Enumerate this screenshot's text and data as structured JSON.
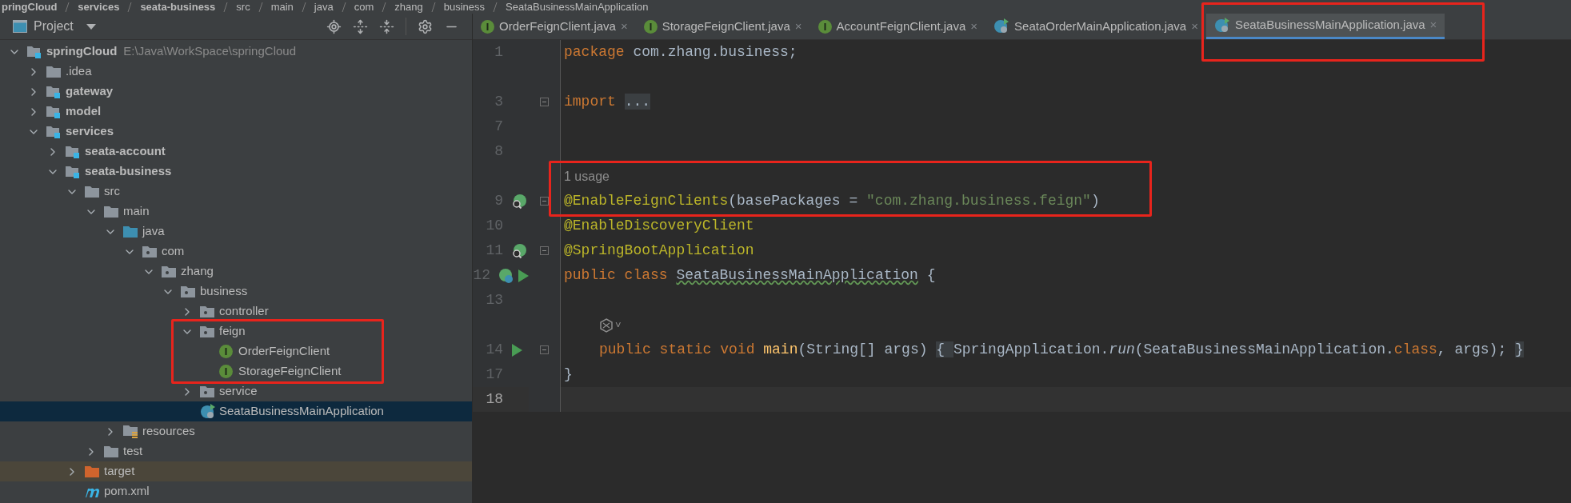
{
  "breadcrumb": [
    "pringCloud",
    "services",
    "seata-business",
    "src",
    "main",
    "java",
    "com",
    "zhang",
    "business",
    "SeataBusinessMainApplication"
  ],
  "project_panel": {
    "title": "Project",
    "tree": [
      {
        "label": "springCloud",
        "kind": "module",
        "bold": true,
        "path": "E:\\Java\\WorkSpace\\springCloud",
        "expanded": true,
        "selected": false,
        "highlighted": false,
        "children": [
          {
            "label": ".idea",
            "kind": "folder",
            "expanded": false,
            "selected": false,
            "highlighted": false
          },
          {
            "label": "gateway",
            "kind": "module",
            "bold": true,
            "expanded": false,
            "selected": false,
            "highlighted": false
          },
          {
            "label": "model",
            "kind": "module",
            "bold": true,
            "expanded": false,
            "selected": false,
            "highlighted": false
          },
          {
            "label": "services",
            "kind": "module",
            "bold": true,
            "expanded": true,
            "selected": false,
            "highlighted": false,
            "children": [
              {
                "label": "seata-account",
                "kind": "module",
                "bold": true,
                "expanded": false,
                "selected": false,
                "highlighted": false
              },
              {
                "label": "seata-business",
                "kind": "module",
                "bold": true,
                "expanded": true,
                "selected": false,
                "highlighted": false,
                "children": [
                  {
                    "label": "src",
                    "kind": "folder",
                    "expanded": true,
                    "selected": false,
                    "highlighted": false,
                    "children": [
                      {
                        "label": "main",
                        "kind": "folder",
                        "expanded": true,
                        "selected": false,
                        "highlighted": false,
                        "children": [
                          {
                            "label": "java",
                            "kind": "source",
                            "expanded": true,
                            "selected": false,
                            "highlighted": false,
                            "children": [
                              {
                                "label": "com",
                                "kind": "package",
                                "expanded": true,
                                "selected": false,
                                "highlighted": false,
                                "children": [
                                  {
                                    "label": "zhang",
                                    "kind": "package",
                                    "expanded": true,
                                    "selected": false,
                                    "highlighted": false,
                                    "children": [
                                      {
                                        "label": "business",
                                        "kind": "package",
                                        "expanded": true,
                                        "selected": false,
                                        "highlighted": false,
                                        "children": [
                                          {
                                            "label": "controller",
                                            "kind": "package",
                                            "expanded": false,
                                            "selected": false,
                                            "highlighted": false
                                          },
                                          {
                                            "label": "feign",
                                            "kind": "package",
                                            "expanded": true,
                                            "selected": false,
                                            "highlighted": true,
                                            "children": [
                                              {
                                                "label": "OrderFeignClient",
                                                "kind": "interface",
                                                "selected": false,
                                                "highlighted": false
                                              },
                                              {
                                                "label": "StorageFeignClient",
                                                "kind": "interface",
                                                "selected": false,
                                                "highlighted": false
                                              }
                                            ]
                                          },
                                          {
                                            "label": "service",
                                            "kind": "package",
                                            "expanded": false,
                                            "selected": false,
                                            "highlighted": false
                                          },
                                          {
                                            "label": "SeataBusinessMainApplication",
                                            "kind": "spring",
                                            "selected": true,
                                            "highlighted": false
                                          }
                                        ]
                                      }
                                    ]
                                  }
                                ]
                              }
                            ]
                          },
                          {
                            "label": "resources",
                            "kind": "resources",
                            "expanded": false,
                            "selected": false,
                            "highlighted": false
                          }
                        ]
                      },
                      {
                        "label": "test",
                        "kind": "folder",
                        "expanded": false,
                        "selected": false,
                        "highlighted": false
                      }
                    ]
                  },
                  {
                    "label": "target",
                    "kind": "excluded",
                    "expanded": false,
                    "selected": false,
                    "highlighted": false
                  },
                  {
                    "label": "pom.xml",
                    "kind": "maven",
                    "selected": false,
                    "highlighted": false
                  }
                ]
              }
            ]
          }
        ]
      }
    ]
  },
  "tabs": [
    {
      "label": "OrderFeignClient.java",
      "kind": "interface",
      "selected": false,
      "highlighted": false
    },
    {
      "label": "StorageFeignClient.java",
      "kind": "interface",
      "selected": false,
      "highlighted": false
    },
    {
      "label": "AccountFeignClient.java",
      "kind": "interface",
      "selected": false,
      "highlighted": false
    },
    {
      "label": "SeataOrderMainApplication.java",
      "kind": "spring",
      "selected": false,
      "highlighted": false
    },
    {
      "label": "SeataBusinessMainApplication.java",
      "kind": "spring",
      "selected": true,
      "highlighted": true
    }
  ],
  "close_glyph": "×",
  "editor": {
    "lines": [
      {
        "kind": "code",
        "number": "1",
        "tokens": [
          {
            "kind": "keyword",
            "text": "package "
          },
          {
            "kind": "plain",
            "text": "com.zhang.business;"
          }
        ]
      },
      {
        "kind": "code"
      },
      {
        "kind": "code",
        "number": "3",
        "fold": true,
        "tokens": [
          {
            "kind": "keyword",
            "text": "import "
          },
          {
            "kind": "folded",
            "text": "..."
          }
        ]
      },
      {
        "kind": "code",
        "number": "7"
      },
      {
        "kind": "code",
        "number": "8"
      },
      {
        "kind": "usage",
        "text": "1 usage",
        "highlighted": true
      },
      {
        "kind": "code",
        "number": "9",
        "gutter": [
          {
            "kind": "bean"
          }
        ],
        "fold": true,
        "highlighted": true,
        "tokens": [
          {
            "kind": "annotation",
            "text": "@EnableFeignClients"
          },
          {
            "kind": "plain",
            "text": "(basePackages = "
          },
          {
            "kind": "string",
            "text": "\"com.zhang.business.feign\""
          },
          {
            "kind": "plain",
            "text": ")"
          }
        ]
      },
      {
        "kind": "code",
        "number": "10",
        "tokens": [
          {
            "kind": "annotation",
            "text": "@EnableDiscoveryClient"
          }
        ]
      },
      {
        "kind": "code",
        "number": "11",
        "gutter": [
          {
            "kind": "bean"
          }
        ],
        "fold": true,
        "tokens": [
          {
            "kind": "annotation",
            "text": "@SpringBootApplication"
          }
        ]
      },
      {
        "kind": "code",
        "number": "12",
        "gutter": [
          {
            "kind": "spring"
          },
          {
            "kind": "run"
          }
        ],
        "tokens": [
          {
            "kind": "keyword",
            "text": "public class "
          },
          {
            "kind": "class-name",
            "text": "SeataBusinessMainApplication"
          },
          {
            "kind": "plain",
            "text": " {"
          }
        ]
      },
      {
        "kind": "code",
        "number": "13"
      },
      {
        "kind": "inlay",
        "text": "˅"
      },
      {
        "kind": "code",
        "number": "14",
        "gutter": [
          {
            "kind": "run"
          }
        ],
        "fold": true,
        "indented": true,
        "tokens": [
          {
            "kind": "keyword",
            "text": "public static void "
          },
          {
            "kind": "method",
            "text": "main"
          },
          {
            "kind": "plain",
            "text": "(String[] args) "
          },
          {
            "kind": "folded",
            "text": "{ "
          },
          {
            "kind": "plain",
            "text": "SpringApplication."
          },
          {
            "kind": "static-call",
            "text": "run"
          },
          {
            "kind": "plain",
            "text": "(SeataBusinessMainApplication."
          },
          {
            "kind": "keyword",
            "text": "class"
          },
          {
            "kind": "plain",
            "text": ", args); "
          },
          {
            "kind": "folded",
            "text": "}"
          }
        ]
      },
      {
        "kind": "code",
        "number": "17",
        "tokens": [
          {
            "kind": "plain",
            "text": "}"
          }
        ]
      },
      {
        "kind": "code",
        "number": "18",
        "current": true
      }
    ]
  }
}
